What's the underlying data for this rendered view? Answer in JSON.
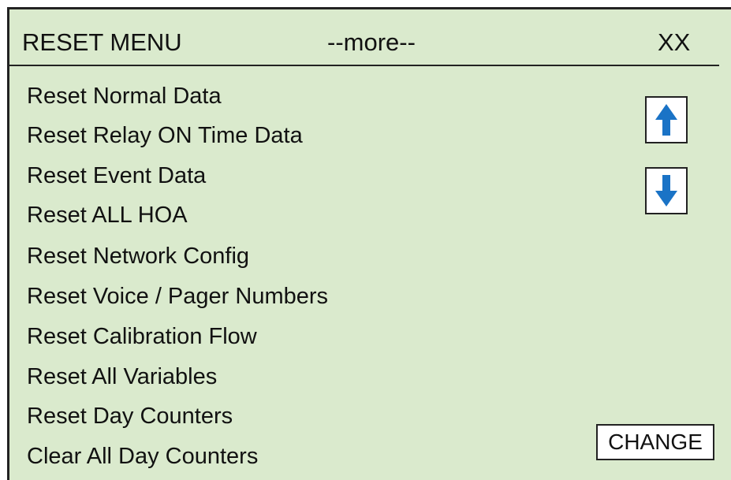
{
  "header": {
    "title": "RESET MENU",
    "more_indicator": "--more--",
    "code": "XX"
  },
  "menu": {
    "items": [
      {
        "label": "Reset Normal Data"
      },
      {
        "label": "Reset Relay ON Time Data"
      },
      {
        "label": "Reset Event Data"
      },
      {
        "label": "Reset ALL HOA"
      },
      {
        "label": "Reset Network Config"
      },
      {
        "label": "Reset Voice / Pager Numbers"
      },
      {
        "label": "Reset Calibration Flow"
      },
      {
        "label": "Reset All Variables"
      },
      {
        "label": "Reset Day Counters"
      },
      {
        "label": "Clear All Day Counters"
      }
    ]
  },
  "controls": {
    "scroll_up_icon": "arrow-up-icon",
    "scroll_down_icon": "arrow-down-icon",
    "change_label": "CHANGE"
  },
  "colors": {
    "screen_background": "#daeacd",
    "arrow_blue": "#1a73c6",
    "border": "#222222"
  }
}
